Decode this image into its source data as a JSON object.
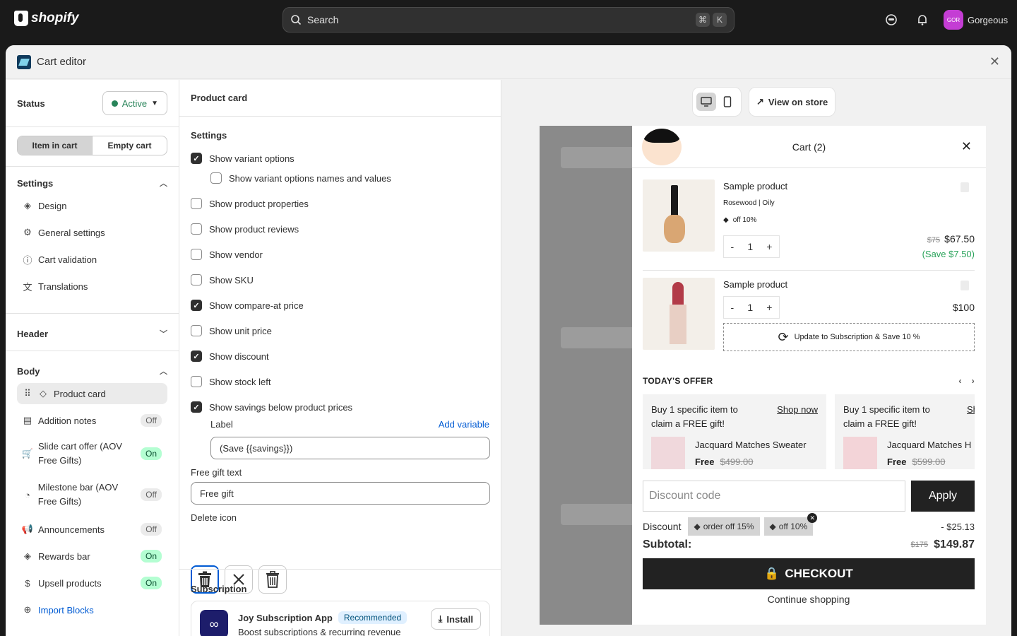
{
  "topbar": {
    "brand": "shopify",
    "search_placeholder": "Search",
    "shortcut": [
      "⌘",
      "K"
    ],
    "store_name": "Gorgeous",
    "store_initials": "GOR"
  },
  "modal": {
    "title": "Cart editor"
  },
  "left": {
    "status_label": "Status",
    "status_value": "Active",
    "tabs": [
      "Item in cart",
      "Empty cart"
    ],
    "settings_header": "Settings",
    "settings_items": [
      "Design",
      "General settings",
      "Cart validation",
      "Translations"
    ],
    "header_section": "Header",
    "body_section": "Body",
    "body_items": [
      {
        "label": "Product card",
        "badge": ""
      },
      {
        "label": "Addition notes",
        "badge": "Off"
      },
      {
        "label": "Slide cart offer (AOV Free Gifts)",
        "badge": "On"
      },
      {
        "label": "Milestone bar (AOV Free Gifts)",
        "badge": "Off"
      },
      {
        "label": "Announcements",
        "badge": "Off"
      },
      {
        "label": "Rewards bar",
        "badge": "On"
      },
      {
        "label": "Upsell products",
        "badge": "On"
      }
    ],
    "import_blocks": "Import Blocks"
  },
  "middle": {
    "title": "Product card",
    "settings_title": "Settings",
    "options": [
      {
        "label": "Show variant options",
        "checked": true
      },
      {
        "label": "Show variant options names and values",
        "checked": false
      },
      {
        "label": "Show product properties",
        "checked": false
      },
      {
        "label": "Show product reviews",
        "checked": false
      },
      {
        "label": "Show vendor",
        "checked": false
      },
      {
        "label": "Show SKU",
        "checked": false
      },
      {
        "label": "Show compare-at price",
        "checked": true
      },
      {
        "label": "Show unit price",
        "checked": false
      },
      {
        "label": "Show discount",
        "checked": true
      },
      {
        "label": "Show stock left",
        "checked": false
      },
      {
        "label": "Show savings below product prices",
        "checked": true
      }
    ],
    "label_label": "Label",
    "add_variable": "Add variable",
    "label_value": "(Save {{savings}})",
    "free_gift_label": "Free gift text",
    "free_gift_value": "Free gift",
    "delete_icon_label": "Delete icon",
    "subscription_title": "Subscription",
    "joy_name": "Joy Subscription App",
    "joy_badge": "Recommended",
    "joy_desc": "Boost subscriptions & recurring revenue",
    "install": "Install"
  },
  "preview": {
    "view_on_store": "View on store",
    "cart_title": "Cart (2)",
    "items": [
      {
        "name": "Sample product",
        "variant": "Rosewood | Oily",
        "discount": "off 10%",
        "qty": "1",
        "compare": "$75",
        "price": "$67.50",
        "save": "(Save $7.50)"
      },
      {
        "name": "Sample product",
        "qty": "1",
        "price": "$100",
        "subscription": "Update to Subscription & Save 10 %"
      }
    ],
    "offer_title": "TODAY'S OFFER",
    "offers": [
      {
        "text": "Buy 1 specific item to claim a FREE gift!",
        "link": "Shop now",
        "product": "Jacquard Matches Sweater",
        "free": "Free",
        "old": "$499.00"
      },
      {
        "text": "Buy 1 specific item to claim a FREE gift!",
        "link": "Sh",
        "product": "Jacquard Matches H",
        "free": "Free",
        "old": "$599.00"
      }
    ],
    "discount_placeholder": "Discount code",
    "apply": "Apply",
    "discount_label": "Discount",
    "chips": [
      "order off 15%",
      "off 10%"
    ],
    "discount_amount": "- $25.13",
    "subtotal_label": "Subtotal:",
    "subtotal_compare": "$175",
    "subtotal": "$149.87",
    "checkout": "CHECKOUT",
    "continue": "Continue shopping"
  },
  "colors": {
    "accent": "#005bd3",
    "success": "#29845a",
    "dark": "#1a1a1a"
  }
}
